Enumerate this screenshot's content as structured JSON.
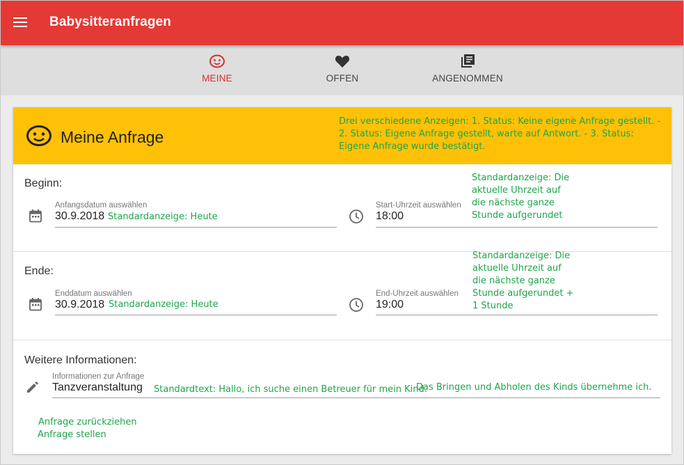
{
  "app": {
    "title": "Babysitteranfragen",
    "accent": "#e53935"
  },
  "tabs": [
    {
      "label": "MEINE",
      "icon": "baby-face-icon",
      "active": true
    },
    {
      "label": "OFFEN",
      "icon": "heart-icon",
      "active": false
    },
    {
      "label": "ANGENOMMEN",
      "icon": "library-books-icon",
      "active": false
    }
  ],
  "card": {
    "title": "Meine Anfrage",
    "header_color": "#ffc107",
    "header_note": "Drei verschiedene Anzeigen: 1. Status: Keine eigene Anfrage gestellt. - 2. Status: Eigene Anfrage gestellt, warte auf Antwort. - 3. Status: Eigene Anfrage wurde bestätigt."
  },
  "begin": {
    "label": "Beginn:",
    "date_label": "Anfangsdatum auswählen",
    "date_value": "30.9.2018",
    "date_note": "Standardanzeige: Heute",
    "time_label": "Start-Uhrzeit auswählen",
    "time_value": "18:00",
    "time_note": "Standardanzeige: Die aktuelle Uhrzeit auf die nächste ganze Stunde aufgerundet"
  },
  "end": {
    "label": "Ende:",
    "date_label": "Enddatum auswählen",
    "date_value": "30.9.2018",
    "date_note": "Standardanzeige: Heute",
    "time_label": "End-Uhrzeit auswählen",
    "time_value": "19:00",
    "time_note": "Standardanzeige: Die aktuelle Uhrzeit auf die nächste ganze Stunde aufgerundet + 1 Stunde"
  },
  "info": {
    "label": "Weitere Informationen:",
    "field_label": "Informationen zur Anfrage",
    "field_value": "Tanzveranstaltung",
    "note1": "Standardtext: Hallo, ich suche einen Betreuer für mein Kind.",
    "note2": "Das Bringen und Abholen des Kinds übernehme ich."
  },
  "actions": {
    "withdraw": "Anfrage zurückziehen",
    "submit": "Anfrage stellen"
  },
  "note_color": "#1ea54a"
}
